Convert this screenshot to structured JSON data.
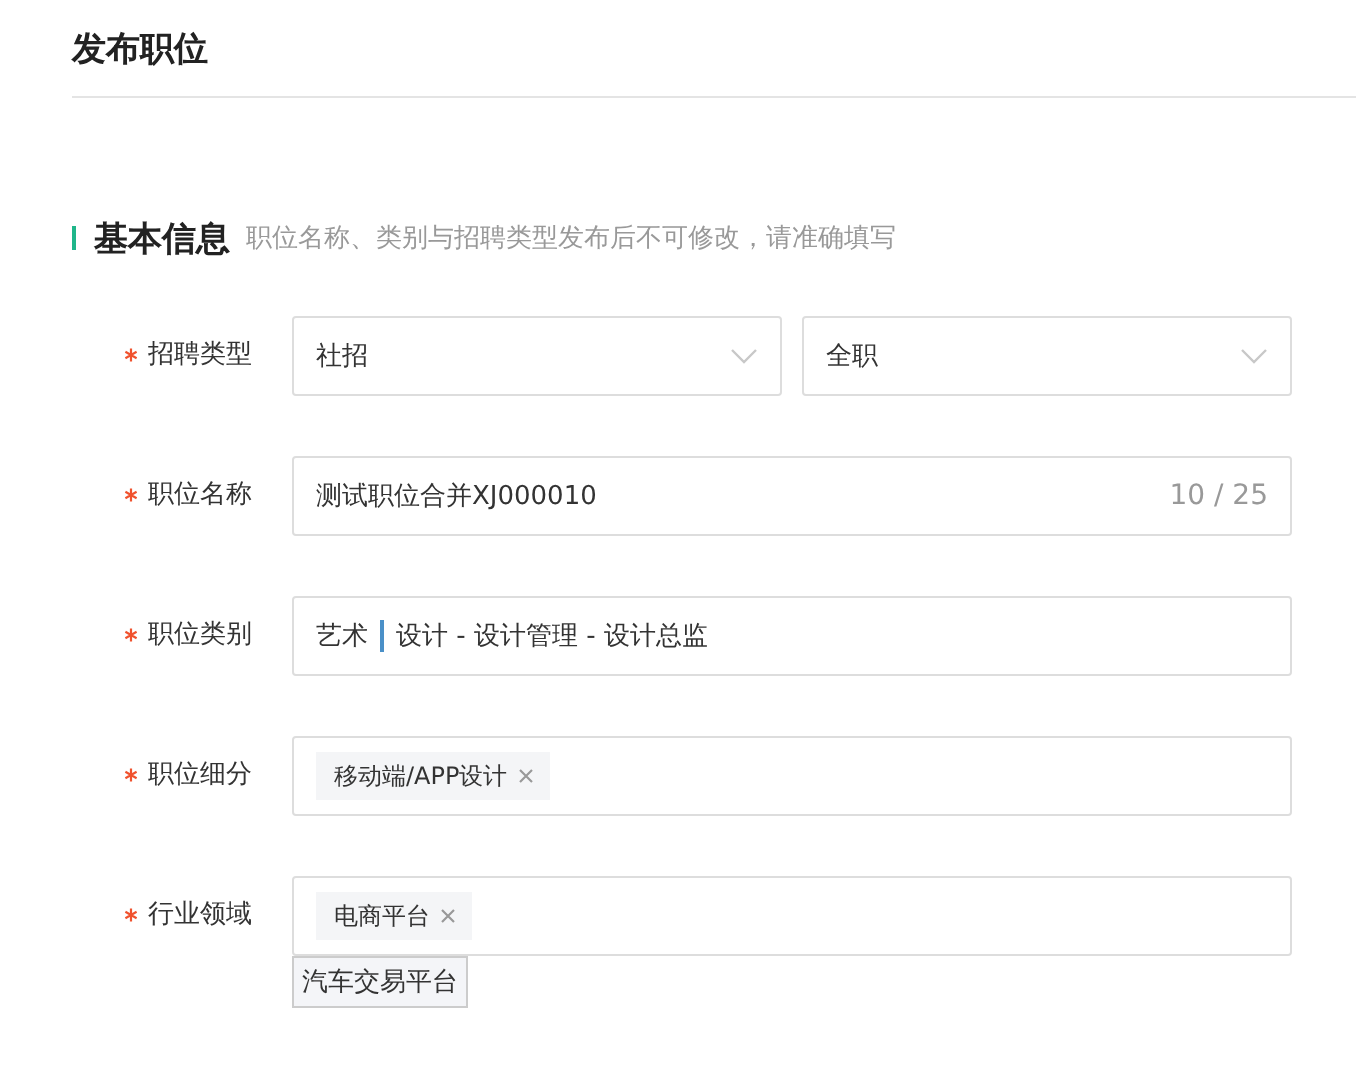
{
  "page_title": "发布职位",
  "section": {
    "title": "基本信息",
    "hint": "职位名称、类别与招聘类型发布后不可修改，请准确填写"
  },
  "fields": [
    {
      "kind": "selects",
      "label": "招聘类型",
      "required": true,
      "selects": [
        {
          "value": "社招"
        },
        {
          "value": "全职"
        }
      ]
    },
    {
      "kind": "counted",
      "label": "职位名称",
      "required": true,
      "value": "测试职位合并XJ000010",
      "count": "10 / 25"
    },
    {
      "kind": "category",
      "label": "职位类别",
      "required": true,
      "main": "艺术",
      "path": "设计 - 设计管理 - 设计总监"
    },
    {
      "kind": "tags",
      "label": "职位细分",
      "required": true,
      "tags": [
        "移动端/APP设计"
      ]
    },
    {
      "kind": "tags",
      "label": "行业领域",
      "required": true,
      "tags": [
        "电商平台"
      ],
      "suggestion": "汽车交易平台"
    }
  ]
}
